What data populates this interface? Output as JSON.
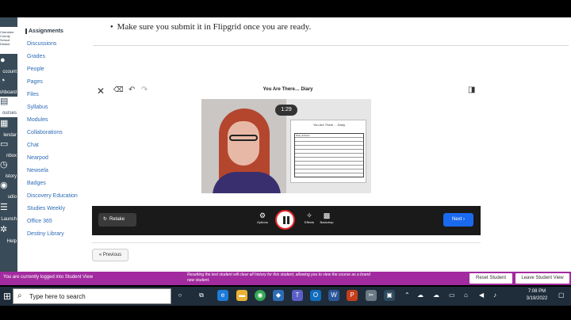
{
  "globalnav": {
    "logo_text": "Cherokee County School District",
    "items": [
      {
        "label": "ccount",
        "icon": "person-icon"
      },
      {
        "label": "shboard",
        "icon": "dashboard-icon"
      },
      {
        "label": "ourses",
        "icon": "book-icon"
      },
      {
        "label": "lendar",
        "icon": "calendar-icon"
      },
      {
        "label": "nbox",
        "icon": "inbox-icon"
      },
      {
        "label": "istory",
        "icon": "clock-icon"
      },
      {
        "label": "udio",
        "icon": "studio-icon"
      },
      {
        "label": "Launch",
        "icon": "launch-icon"
      },
      {
        "label": "Help",
        "icon": "help-icon"
      }
    ]
  },
  "coursenav": {
    "items": [
      "Assignments",
      "Discussions",
      "Grades",
      "People",
      "Pages",
      "Files",
      "Syllabus",
      "Modules",
      "Collaborations",
      "Chat",
      "Nearpod",
      "Newsela",
      "Badges",
      "Discovery Education",
      "Studies Weekly",
      "Office 365",
      "Destiny Library"
    ]
  },
  "content": {
    "bullet_text": "Make sure you submit it in Flipgrid once you are ready."
  },
  "flipgrid": {
    "topic_title": "You Are There… Diary",
    "timer": "1:29",
    "paper_title": "You Are There ... Diary",
    "paper_label": "Diary Entries:",
    "retake_label": "Retake",
    "options_label": "Options",
    "effects_label": "Effects",
    "backdrop_label": "Backdrop",
    "next_label": "Next",
    "previous_label": "« Previous"
  },
  "student_view": {
    "logged_in_text": "You are currently logged into Student View",
    "reset_note": "Resetting the test student will clear all history for this student, allowing you to view the course as a brand new student.",
    "reset_button": "Reset Student",
    "leave_button": "Leave Student View"
  },
  "taskbar": {
    "search_placeholder": "Type here to search",
    "time": "7:08 PM",
    "date": "3/19/2022"
  }
}
